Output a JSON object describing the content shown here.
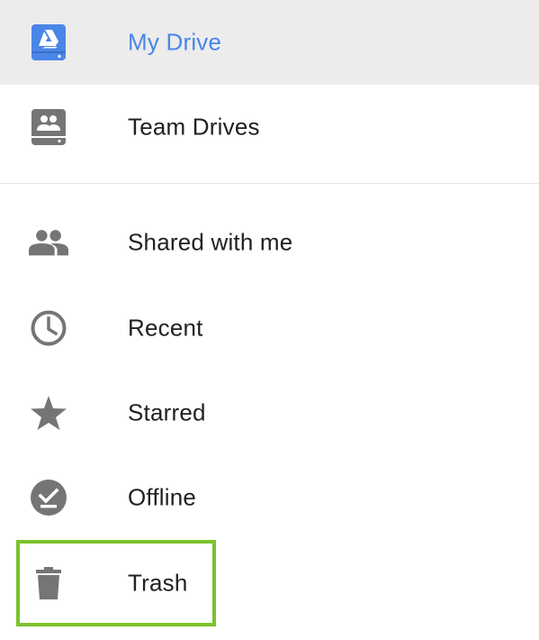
{
  "nav": {
    "items": [
      {
        "label": "My Drive",
        "icon": "drive-icon",
        "selected": true
      },
      {
        "label": "Team Drives",
        "icon": "team-drives-icon",
        "selected": false
      },
      {
        "label": "Shared with me",
        "icon": "people-icon",
        "selected": false
      },
      {
        "label": "Recent",
        "icon": "clock-icon",
        "selected": false
      },
      {
        "label": "Starred",
        "icon": "star-icon",
        "selected": false
      },
      {
        "label": "Offline",
        "icon": "offline-check-icon",
        "selected": false
      },
      {
        "label": "Trash",
        "icon": "trash-icon",
        "selected": false
      }
    ]
  },
  "colors": {
    "selected_text": "#4a86e8",
    "selected_background": "#ececec",
    "icon_gray": "#757575",
    "highlight_border": "#7cc22b"
  }
}
